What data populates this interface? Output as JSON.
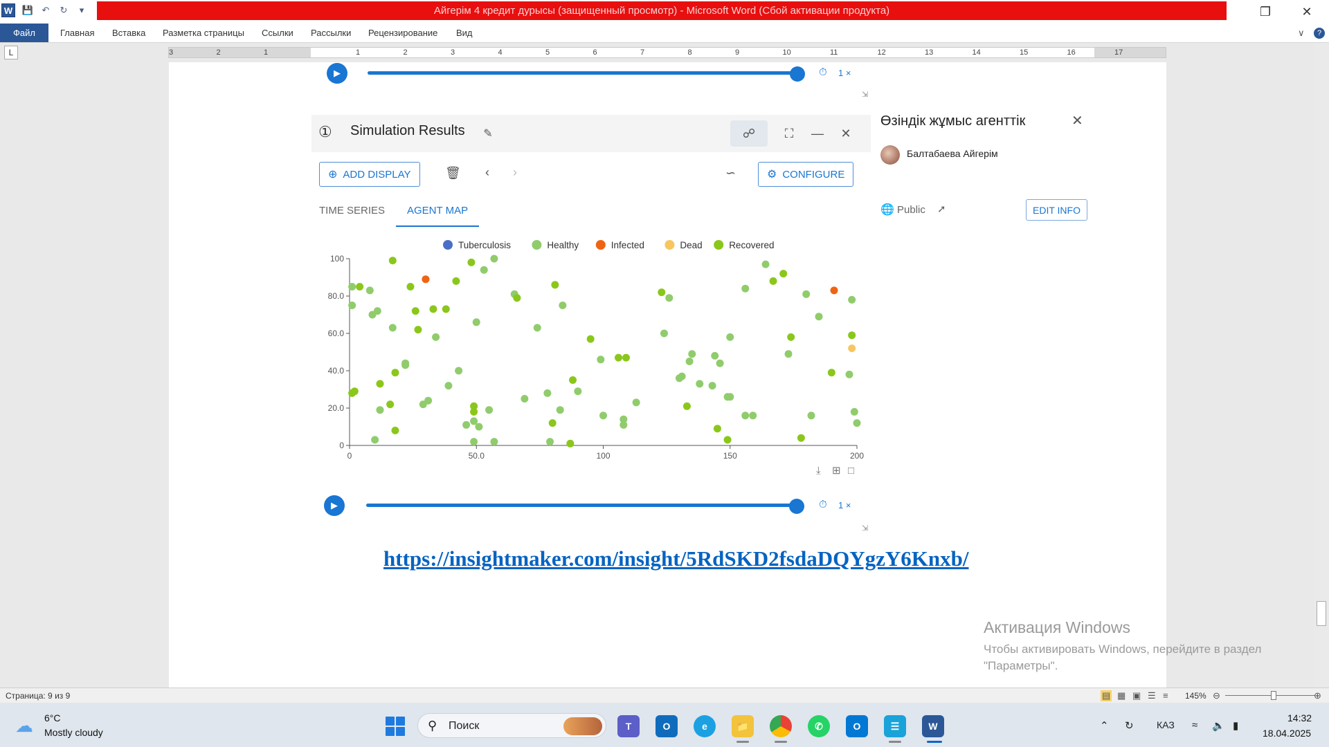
{
  "window": {
    "title": "Айгерім 4 кредит дурысы (защищенный просмотр)  -  Microsoft Word (Сбой активации продукта)",
    "app_icon": "W"
  },
  "ribbon": {
    "file": "Файл",
    "tabs": [
      "Главная",
      "Вставка",
      "Разметка страницы",
      "Ссылки",
      "Рассылки",
      "Рецензирование",
      "Вид"
    ]
  },
  "ruler": {
    "left_numbers": [
      "3",
      "2",
      "1"
    ],
    "right_numbers": [
      "1",
      "2",
      "3",
      "4",
      "5",
      "6",
      "7",
      "8",
      "9",
      "10",
      "11",
      "12",
      "13",
      "14",
      "15",
      "16",
      "17"
    ]
  },
  "player": {
    "speed": "1 ×"
  },
  "sim": {
    "panel_number": "①",
    "title": "Simulation Results",
    "add_display": "ADD DISPLAY",
    "configure": "CONFIGURE",
    "tabs": {
      "time_series": "TIME SERIES",
      "agent_map": "AGENT MAP"
    }
  },
  "chart_data": {
    "type": "scatter",
    "title": "",
    "xlabel": "",
    "ylabel": "",
    "xlim": [
      0,
      200
    ],
    "ylim": [
      0,
      100
    ],
    "x_ticks": [
      "0",
      "50.0",
      "100",
      "150",
      "200"
    ],
    "y_ticks": [
      "0",
      "20.0",
      "40.0",
      "60.0",
      "80.0",
      "100"
    ],
    "legend_position": "top-center",
    "legend": [
      {
        "name": "Tuberculosis",
        "color": "#4a6ec8"
      },
      {
        "name": "Healthy",
        "color": "#90cc6c"
      },
      {
        "name": "Infected",
        "color": "#ef6412"
      },
      {
        "name": "Dead",
        "color": "#f7c660"
      },
      {
        "name": "Recovered",
        "color": "#8bc71b"
      }
    ],
    "series": [
      {
        "name": "Healthy",
        "color": "#90cc6c",
        "points": [
          [
            1,
            85
          ],
          [
            1,
            75
          ],
          [
            8,
            83
          ],
          [
            9,
            70
          ],
          [
            10,
            3
          ],
          [
            11,
            72
          ],
          [
            12,
            19
          ],
          [
            17,
            63
          ],
          [
            22,
            43
          ],
          [
            22,
            44
          ],
          [
            29,
            22
          ],
          [
            31,
            24
          ],
          [
            34,
            58
          ],
          [
            39,
            32
          ],
          [
            43,
            40
          ],
          [
            46,
            11
          ],
          [
            49,
            2
          ],
          [
            49,
            13
          ],
          [
            50,
            66
          ],
          [
            51,
            10
          ],
          [
            53,
            94
          ],
          [
            55,
            19
          ],
          [
            57,
            100
          ],
          [
            57,
            2
          ],
          [
            65,
            81
          ],
          [
            69,
            25
          ],
          [
            74,
            63
          ],
          [
            78,
            28
          ],
          [
            79,
            2
          ],
          [
            83,
            19
          ],
          [
            84,
            75
          ],
          [
            90,
            29
          ],
          [
            99,
            46
          ],
          [
            100,
            16
          ],
          [
            108,
            14
          ],
          [
            108,
            11
          ],
          [
            113,
            23
          ],
          [
            124,
            60
          ],
          [
            126,
            79
          ],
          [
            130,
            36
          ],
          [
            131,
            37
          ],
          [
            134,
            45
          ],
          [
            135,
            49
          ],
          [
            138,
            33
          ],
          [
            143,
            32
          ],
          [
            144,
            48
          ],
          [
            146,
            44
          ],
          [
            149,
            26
          ],
          [
            150,
            26
          ],
          [
            150,
            58
          ],
          [
            156,
            16
          ],
          [
            156,
            84
          ],
          [
            159,
            16
          ],
          [
            164,
            97
          ],
          [
            173,
            49
          ],
          [
            180,
            81
          ],
          [
            182,
            16
          ],
          [
            185,
            69
          ],
          [
            197,
            38
          ],
          [
            198,
            78
          ],
          [
            199,
            18
          ],
          [
            200,
            12
          ]
        ]
      },
      {
        "name": "Recovered",
        "color": "#8bc71b",
        "points": [
          [
            1,
            28
          ],
          [
            2,
            29
          ],
          [
            4,
            85
          ],
          [
            12,
            33
          ],
          [
            16,
            22
          ],
          [
            17,
            99
          ],
          [
            18,
            8
          ],
          [
            18,
            39
          ],
          [
            24,
            85
          ],
          [
            26,
            72
          ],
          [
            27,
            62
          ],
          [
            33,
            73
          ],
          [
            38,
            73
          ],
          [
            42,
            88
          ],
          [
            48,
            98
          ],
          [
            49,
            21
          ],
          [
            49,
            18
          ],
          [
            66,
            79
          ],
          [
            80,
            12
          ],
          [
            81,
            86
          ],
          [
            87,
            1
          ],
          [
            88,
            35
          ],
          [
            95,
            57
          ],
          [
            106,
            47
          ],
          [
            109,
            47
          ],
          [
            123,
            82
          ],
          [
            133,
            21
          ],
          [
            145,
            9
          ],
          [
            149,
            3
          ],
          [
            167,
            88
          ],
          [
            171,
            92
          ],
          [
            174,
            58
          ],
          [
            178,
            4
          ],
          [
            190,
            39
          ],
          [
            198,
            59
          ]
        ]
      },
      {
        "name": "Infected",
        "color": "#ef6412",
        "points": [
          [
            30,
            89
          ],
          [
            191,
            83
          ]
        ]
      },
      {
        "name": "Dead",
        "color": "#f7c660",
        "points": [
          [
            198,
            52
          ]
        ]
      }
    ]
  },
  "side": {
    "title": "Өзіндік жұмыс агенттік",
    "author": "Балтабаева Айгерім",
    "visibility": "Public",
    "edit_info": "EDIT INFO"
  },
  "document": {
    "link": "https://insightmaker.com/insight/5RdSKD2fsdaDQYgzY6Knxb/"
  },
  "activation": {
    "title": "Активация Windows",
    "line1": "Чтобы активировать Windows, перейдите в раздел",
    "line2": "\"Параметры\"."
  },
  "status": {
    "page": "Страница: 9 из 9",
    "zoom": "145%"
  },
  "taskbar": {
    "temp": "6°C",
    "weather": "Mostly cloudy",
    "search": "Поиск",
    "lang": "КАЗ",
    "time": "14:32",
    "date": "18.04.2025"
  }
}
